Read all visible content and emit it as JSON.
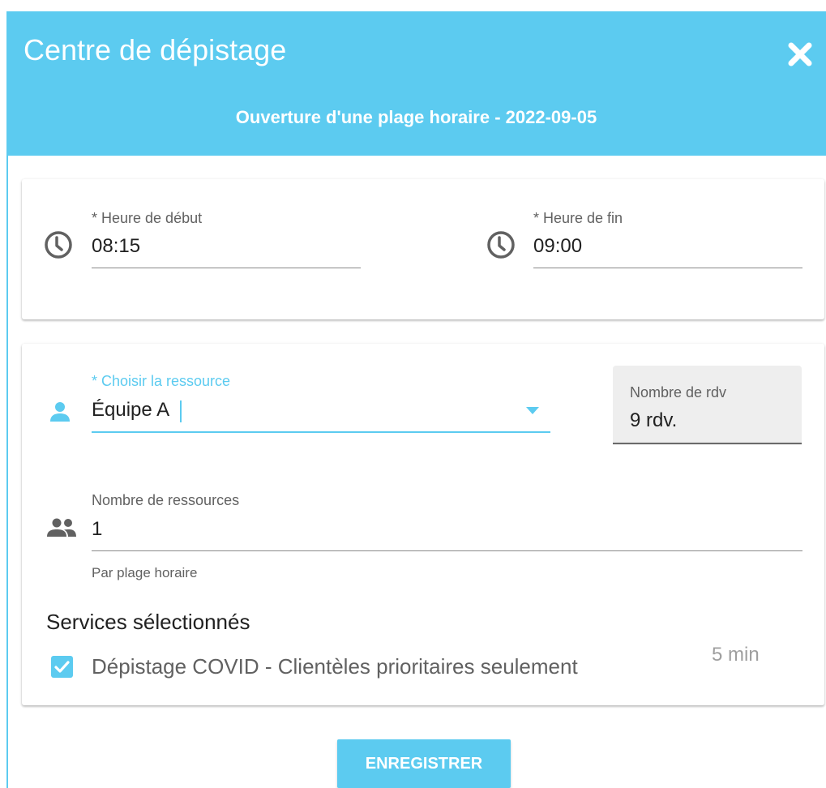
{
  "dialog": {
    "title": "Centre de dépistage",
    "subtitle": "Ouverture d'une plage horaire - 2022-09-05",
    "close_icon": "close-icon",
    "accent_color": "#5ccbf0"
  },
  "time": {
    "start_label": "* Heure de début",
    "start_value": "08:15",
    "end_label": "* Heure de fin",
    "end_value": "09:00",
    "icon": "clock-icon"
  },
  "resource": {
    "label": "* Choisir la ressource",
    "value": "Équipe A",
    "icon": "person-icon",
    "dropdown_icon": "dropdown-arrow-icon"
  },
  "appointments": {
    "label": "Nombre de rdv",
    "value": "9 rdv."
  },
  "resource_count": {
    "label": "Nombre de ressources",
    "value": "1",
    "helper": "Par plage horaire",
    "icon": "people-icon"
  },
  "services": {
    "title": "Services sélectionnés",
    "items": [
      {
        "label": "Dépistage COVID - Clientèles prioritaires seulement",
        "duration": "5 min",
        "checked": true
      }
    ]
  },
  "actions": {
    "save_label": "ENREGISTRER"
  }
}
